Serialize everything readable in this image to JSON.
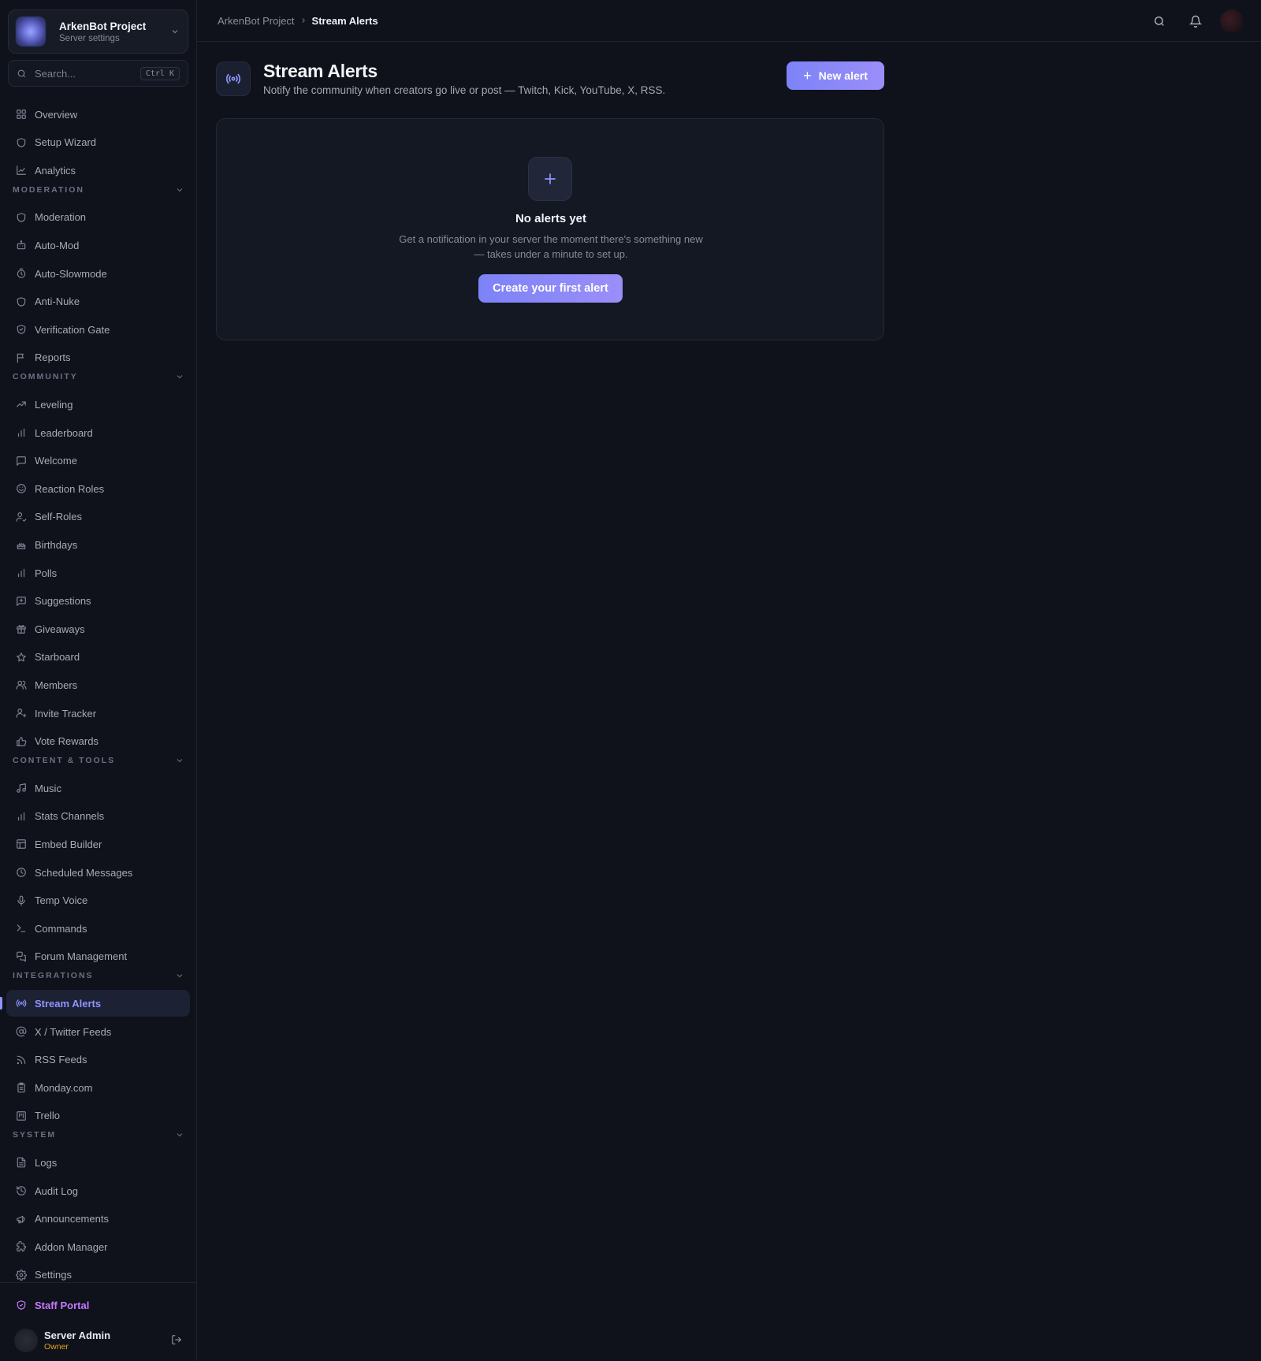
{
  "project": {
    "name": "ArkenBot Project",
    "subtitle": "Server settings"
  },
  "search": {
    "placeholder": "Search...",
    "shortcut": "Ctrl K"
  },
  "nav": {
    "top": [
      {
        "label": "Overview",
        "icon": "grid-icon"
      },
      {
        "label": "Setup Wizard",
        "icon": "shield-icon"
      },
      {
        "label": "Analytics",
        "icon": "chart-line-icon"
      }
    ],
    "sections": [
      {
        "title": "MODERATION",
        "items": [
          {
            "label": "Moderation",
            "icon": "shield-icon"
          },
          {
            "label": "Auto-Mod",
            "icon": "bot-icon"
          },
          {
            "label": "Auto-Slowmode",
            "icon": "timer-icon"
          },
          {
            "label": "Anti-Nuke",
            "icon": "shield-icon"
          },
          {
            "label": "Verification Gate",
            "icon": "shield-check-icon"
          },
          {
            "label": "Reports",
            "icon": "flag-icon"
          }
        ]
      },
      {
        "title": "COMMUNITY",
        "items": [
          {
            "label": "Leveling",
            "icon": "trending-up-icon"
          },
          {
            "label": "Leaderboard",
            "icon": "bar-chart-icon"
          },
          {
            "label": "Welcome",
            "icon": "message-icon"
          },
          {
            "label": "Reaction Roles",
            "icon": "smile-icon"
          },
          {
            "label": "Self-Roles",
            "icon": "user-check-icon"
          },
          {
            "label": "Birthdays",
            "icon": "cake-icon"
          },
          {
            "label": "Polls",
            "icon": "bar-chart-icon"
          },
          {
            "label": "Suggestions",
            "icon": "message-plus-icon"
          },
          {
            "label": "Giveaways",
            "icon": "gift-icon"
          },
          {
            "label": "Starboard",
            "icon": "star-icon"
          },
          {
            "label": "Members",
            "icon": "users-icon"
          },
          {
            "label": "Invite Tracker",
            "icon": "user-plus-icon"
          },
          {
            "label": "Vote Rewards",
            "icon": "thumbs-up-icon"
          }
        ]
      },
      {
        "title": "CONTENT & TOOLS",
        "items": [
          {
            "label": "Music",
            "icon": "music-icon"
          },
          {
            "label": "Stats Channels",
            "icon": "bar-chart-icon"
          },
          {
            "label": "Embed Builder",
            "icon": "layout-icon"
          },
          {
            "label": "Scheduled Messages",
            "icon": "clock-icon"
          },
          {
            "label": "Temp Voice",
            "icon": "mic-icon"
          },
          {
            "label": "Commands",
            "icon": "terminal-icon"
          },
          {
            "label": "Forum Management",
            "icon": "messages-icon"
          }
        ]
      },
      {
        "title": "INTEGRATIONS",
        "items": [
          {
            "label": "Stream Alerts",
            "icon": "radio-icon",
            "active": true
          },
          {
            "label": "X / Twitter Feeds",
            "icon": "at-sign-icon"
          },
          {
            "label": "RSS Feeds",
            "icon": "rss-icon"
          },
          {
            "label": "Monday.com",
            "icon": "clipboard-icon"
          },
          {
            "label": "Trello",
            "icon": "kanban-icon"
          }
        ]
      },
      {
        "title": "SYSTEM",
        "items": [
          {
            "label": "Logs",
            "icon": "file-text-icon"
          },
          {
            "label": "Audit Log",
            "icon": "history-icon"
          },
          {
            "label": "Announcements",
            "icon": "megaphone-icon"
          },
          {
            "label": "Addon Manager",
            "icon": "puzzle-icon"
          },
          {
            "label": "Settings",
            "icon": "gear-icon"
          }
        ]
      }
    ]
  },
  "footer": {
    "staff_portal": "Staff Portal",
    "user_name": "Server Admin",
    "user_role": "Owner"
  },
  "breadcrumb": {
    "root": "ArkenBot Project",
    "current": "Stream Alerts"
  },
  "page": {
    "title": "Stream Alerts",
    "subtitle": "Notify the community when creators go live or post — Twitch, Kick, YouTube, X, RSS.",
    "new_button": "New alert"
  },
  "empty": {
    "title": "No alerts yet",
    "description": "Get a notification in your server the moment there's something new — takes under a minute to set up.",
    "button": "Create your first alert"
  },
  "colors": {
    "accent": "#8e95ff",
    "staff": "#c778ff",
    "owner": "#e3a218",
    "background": "#0f121a"
  }
}
